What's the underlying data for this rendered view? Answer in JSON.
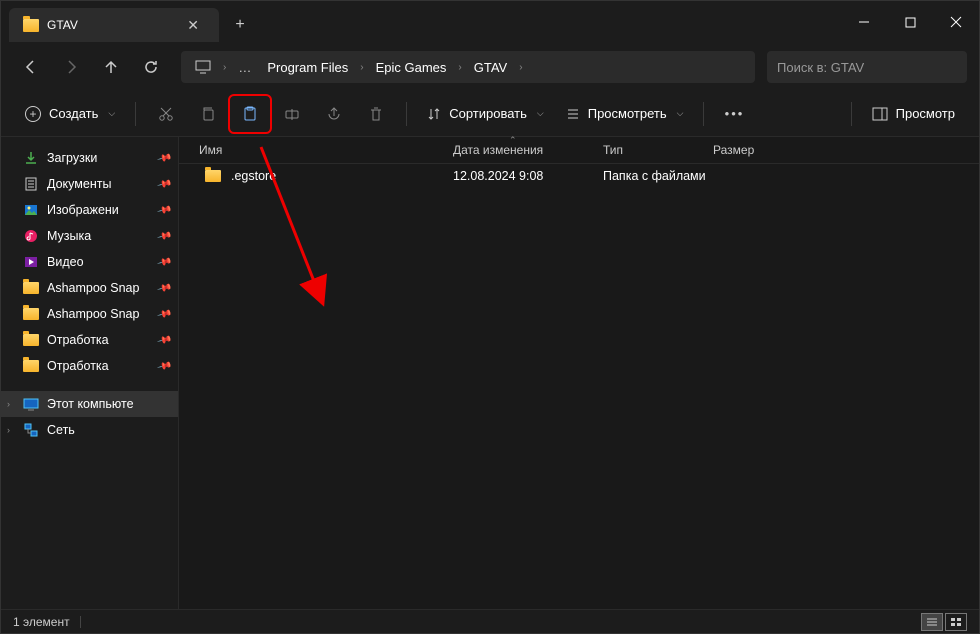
{
  "tab": {
    "title": "GTAV"
  },
  "breadcrumb": [
    "Program Files",
    "Epic Games",
    "GTAV"
  ],
  "search_placeholder": "Поиск в: GTAV",
  "toolbar": {
    "create": "Создать",
    "sort": "Сортировать",
    "view": "Просмотреть",
    "preview": "Просмотр"
  },
  "sidebar": {
    "quick": [
      {
        "label": "Загрузки",
        "icon": "download"
      },
      {
        "label": "Документы",
        "icon": "doc"
      },
      {
        "label": "Изображени",
        "icon": "img"
      },
      {
        "label": "Музыка",
        "icon": "music"
      },
      {
        "label": "Видео",
        "icon": "video"
      },
      {
        "label": "Ashampoo Snap",
        "icon": "folder"
      },
      {
        "label": "Ashampoo Snap",
        "icon": "folder"
      },
      {
        "label": "Отработка",
        "icon": "folder"
      },
      {
        "label": "Отработка",
        "icon": "folder"
      }
    ],
    "pc": "Этот компьюте",
    "net": "Сеть"
  },
  "columns": {
    "name": "Имя",
    "date": "Дата изменения",
    "type": "Тип",
    "size": "Размер"
  },
  "rows": [
    {
      "name": ".egstore",
      "date": "12.08.2024 9:08",
      "type": "Папка с файлами",
      "size": ""
    }
  ],
  "status": "1 элемент"
}
